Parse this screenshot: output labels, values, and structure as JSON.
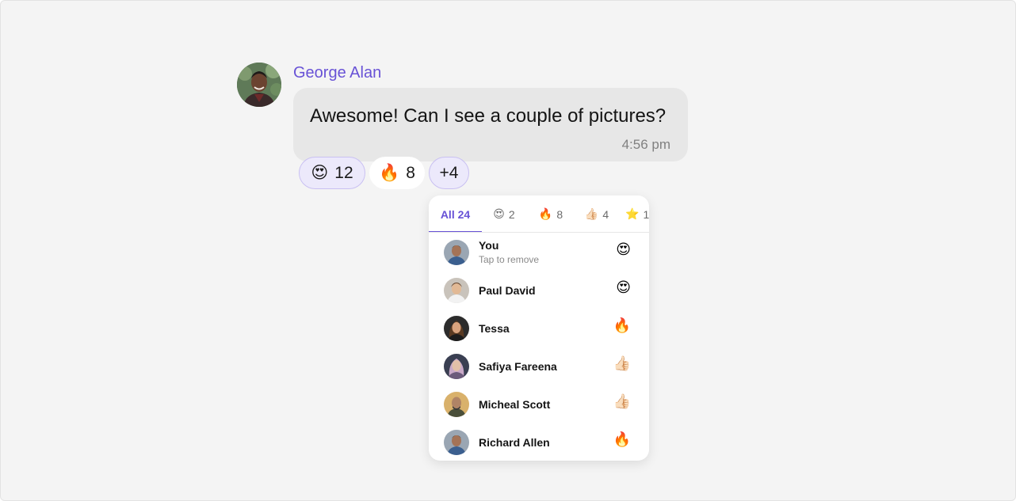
{
  "message": {
    "sender": "George Alan",
    "text": "Awesome! Can I see a couple of pictures?",
    "time": "4:56 pm"
  },
  "reaction_chips": [
    {
      "emoji": "😍",
      "count": "12",
      "active": true
    },
    {
      "emoji": "🔥",
      "count": "8",
      "active": false
    },
    {
      "more": "+4"
    }
  ],
  "reactions_panel": {
    "tabs": [
      {
        "label": "All 24",
        "selected": true
      },
      {
        "emoji": "😍",
        "count": "2"
      },
      {
        "emoji": "🔥",
        "count": "8"
      },
      {
        "emoji": "👍🏻",
        "count": "4"
      },
      {
        "emoji": "⭐",
        "count": "1"
      }
    ],
    "users": [
      {
        "name": "You",
        "sub": "Tap to remove",
        "emoji": "😍"
      },
      {
        "name": "Paul David",
        "emoji": "😍"
      },
      {
        "name": "Tessa",
        "emoji": "🔥"
      },
      {
        "name": "Safiya Fareena",
        "emoji": "👍🏻"
      },
      {
        "name": "Micheal Scott",
        "emoji": "👍🏻"
      },
      {
        "name": "Richard Allen",
        "emoji": "🔥"
      }
    ]
  },
  "colors": {
    "accent": "#6852d6",
    "bubble": "#e7e7e7",
    "background": "#f4f4f4",
    "chip_active_bg": "#ece9fb"
  }
}
